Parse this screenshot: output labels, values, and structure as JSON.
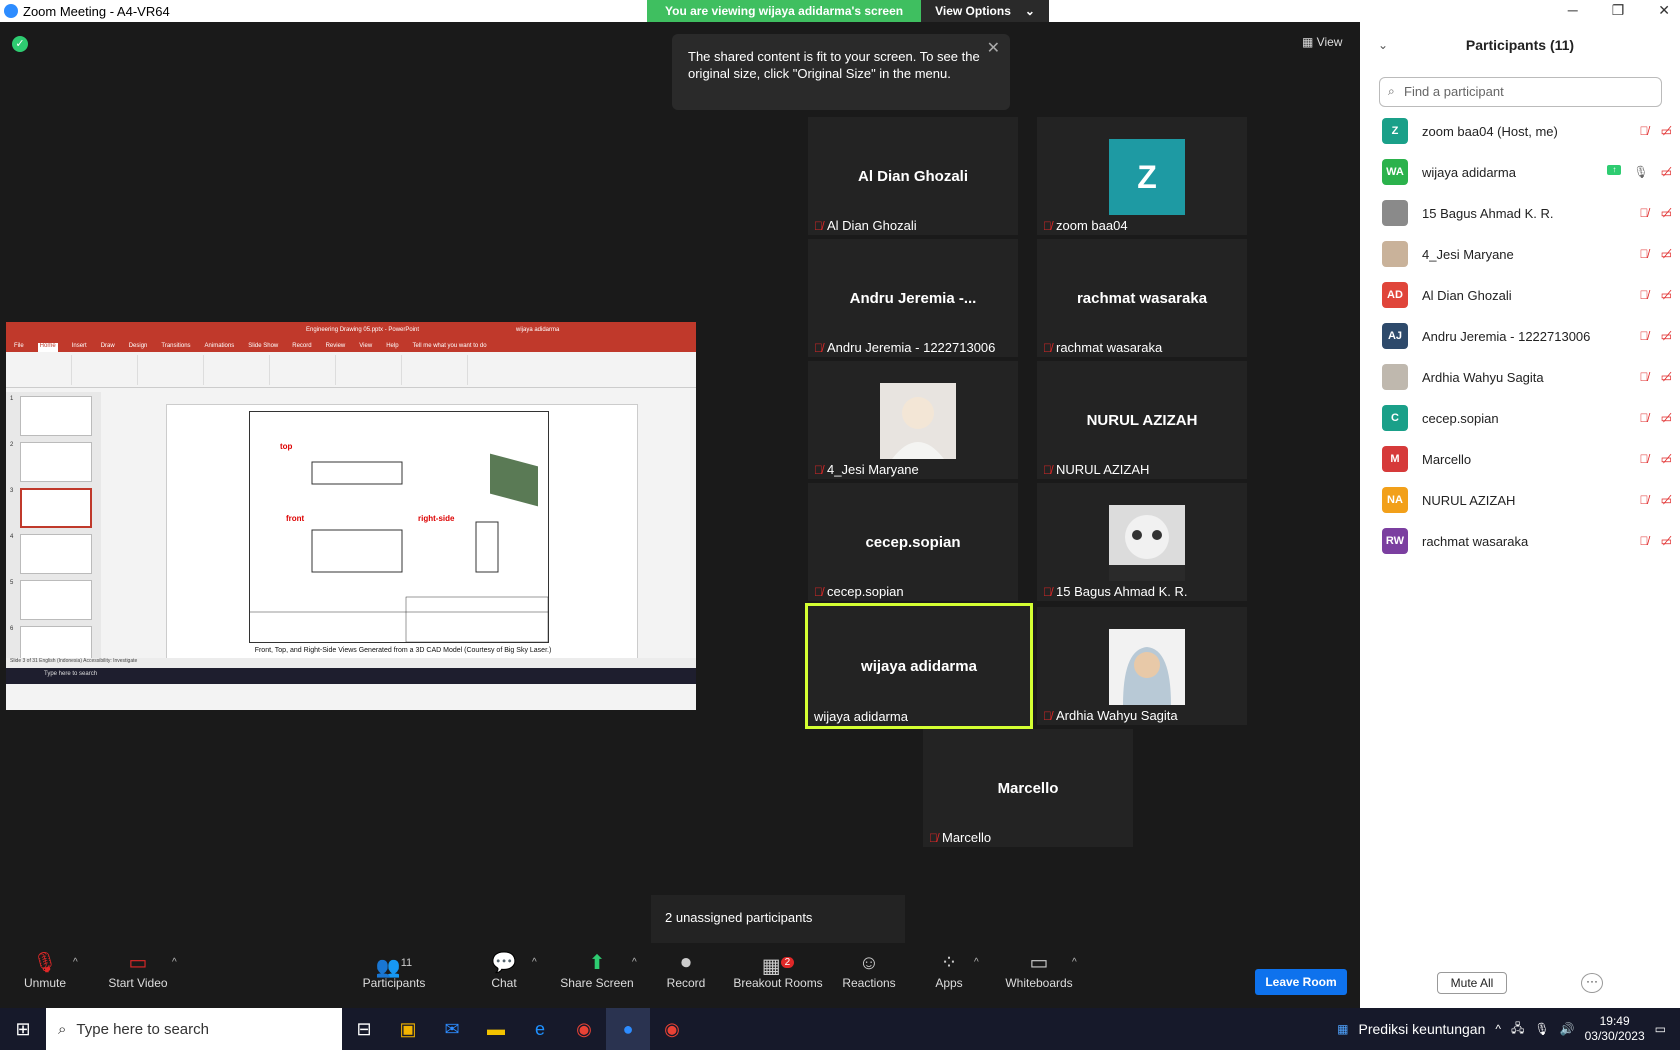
{
  "window": {
    "title": "Zoom Meeting - A4-VR64"
  },
  "share_banner": {
    "viewing": "You are viewing wijaya adidarma's screen",
    "view_options": "View Options"
  },
  "view_button": "View",
  "tooltip": {
    "text": "The shared content is fit to your screen. To see the original size, click \"Original Size\" in the menu."
  },
  "shared_screen": {
    "ppt_title": "Engineering Drawing 05.pptx - PowerPoint",
    "ppt_user": "wijaya adidarma",
    "menu": [
      "File",
      "Home",
      "Insert",
      "Draw",
      "Design",
      "Transitions",
      "Animations",
      "Slide Show",
      "Record",
      "Review",
      "View",
      "Help",
      "Tell me what you want to do"
    ],
    "thumb_numbers": [
      "1",
      "2",
      "3",
      "4",
      "5",
      "6"
    ],
    "slide_labels": {
      "top": "top",
      "front": "front",
      "right_side": "right-side"
    },
    "caption": "Front, Top, and Right-Side Views Generated from a 3D CAD Model (Courtesy of Big Sky Laser.)",
    "status": "Slide 3 of 31   English (Indonesia)   Accessibility: Investigate",
    "taskbar_search": "Type here to search"
  },
  "tiles": [
    {
      "name": "Al Dian Ghozali",
      "center": "Al Dian Ghozali",
      "kind": "text"
    },
    {
      "name": "zoom baa04",
      "center": "Z",
      "kind": "avatar"
    },
    {
      "name": "Andru Jeremia - 1222713006",
      "center": "Andru Jeremia -...",
      "kind": "text"
    },
    {
      "name": "rachmat wasaraka",
      "center": "rachmat wasaraka",
      "kind": "text"
    },
    {
      "name": "4_Jesi Maryane",
      "center": "",
      "kind": "photo"
    },
    {
      "name": "NURUL AZIZAH",
      "center": "NURUL AZIZAH",
      "kind": "text"
    },
    {
      "name": "cecep.sopian",
      "center": "cecep.sopian",
      "kind": "text"
    },
    {
      "name": "15 Bagus Ahmad K. R.",
      "center": "",
      "kind": "photo"
    },
    {
      "name": "wijaya adidarma",
      "center": "wijaya adidarma",
      "kind": "text"
    },
    {
      "name": "Ardhia Wahyu Sagita",
      "center": "",
      "kind": "photo"
    },
    {
      "name": "Marcello",
      "center": "Marcello",
      "kind": "text"
    }
  ],
  "unassigned": "2 unassigned participants",
  "toolbar": {
    "unmute": "Unmute",
    "start_video": "Start Video",
    "participants": "Participants",
    "participants_count": "11",
    "chat": "Chat",
    "share_screen": "Share Screen",
    "record": "Record",
    "breakout": "Breakout Rooms",
    "breakout_badge": "2",
    "reactions": "Reactions",
    "apps": "Apps",
    "whiteboards": "Whiteboards",
    "leave": "Leave Room"
  },
  "panel": {
    "title": "Participants (11)",
    "search_placeholder": "Find a participant",
    "participants": [
      {
        "initials": "Z",
        "name": "zoom baa04 (Host, me)",
        "color": "#1aa089"
      },
      {
        "initials": "WA",
        "name": "wijaya adidarma",
        "color": "#2bb24c"
      },
      {
        "initials": "",
        "name": "15 Bagus Ahmad K. R.",
        "color": "#8a8a8a"
      },
      {
        "initials": "",
        "name": "4_Jesi Maryane",
        "color": "#c9b29a"
      },
      {
        "initials": "AD",
        "name": "Al Dian Ghozali",
        "color": "#e0453a"
      },
      {
        "initials": "AJ",
        "name": "Andru Jeremia - 1222713006",
        "color": "#2e4a6b"
      },
      {
        "initials": "",
        "name": "Ardhia Wahyu Sagita",
        "color": "#bfb8ae"
      },
      {
        "initials": "C",
        "name": "cecep.sopian",
        "color": "#1aa089"
      },
      {
        "initials": "M",
        "name": "Marcello",
        "color": "#d63a3a"
      },
      {
        "initials": "NA",
        "name": "NURUL AZIZAH",
        "color": "#f2a01a"
      },
      {
        "initials": "RW",
        "name": "rachmat wasaraka",
        "color": "#7b3fa0"
      }
    ],
    "mute_all": "Mute All",
    "more": "···"
  },
  "taskbar": {
    "search": "Type here to search",
    "notification": "Prediksi keuntungan",
    "time": "19:49",
    "date": "03/30/2023"
  }
}
